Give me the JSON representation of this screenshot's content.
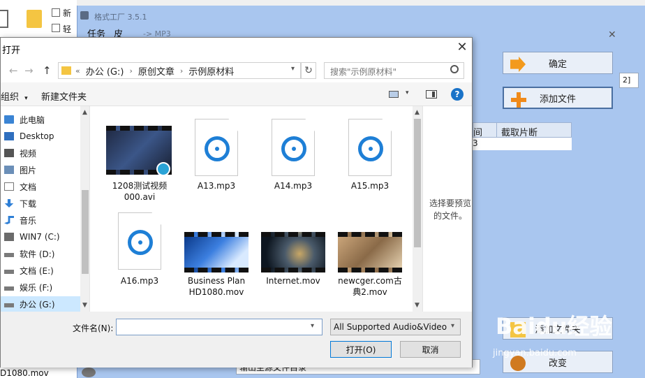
{
  "background_explorer": {
    "label_top1": "新",
    "label_top2": "轻",
    "bottom_file": "D1080.mov"
  },
  "format_factory": {
    "title": "格式工厂 3.5.1",
    "menu_task": "任务",
    "menu_skin": "皮",
    "crumb": "-> MP3",
    "confirm_button": "确定",
    "add_file_button": "添加文件",
    "table_col_time": "间",
    "table_col_clip": "截取片断",
    "row_value": "3",
    "side_num": "2]",
    "add_folder_button": "添加文件夹",
    "change_button": "改变",
    "bottom_field": "输出至源文件目录"
  },
  "dialog": {
    "title": "打开",
    "close_glyph": "✕",
    "breadcrumbs": [
      "«",
      "办公 (G:)",
      "原创文章",
      "示例原材料"
    ],
    "search_placeholder": "搜索\"示例原材料\"",
    "toolbar_organize": "组织",
    "toolbar_new_folder": "新建文件夹",
    "help_glyph": "?",
    "tree": [
      {
        "label": "此电脑",
        "icon": "computer-icon"
      },
      {
        "label": "Desktop",
        "icon": "desktop-icon"
      },
      {
        "label": "视频",
        "icon": "video-folder-icon"
      },
      {
        "label": "图片",
        "icon": "picture-folder-icon"
      },
      {
        "label": "文档",
        "icon": "document-folder-icon"
      },
      {
        "label": "下载",
        "icon": "download-icon"
      },
      {
        "label": "音乐",
        "icon": "music-icon"
      },
      {
        "label": "WIN7 (C:)",
        "icon": "windows-drive-icon"
      },
      {
        "label": "软件 (D:)",
        "icon": "drive-icon"
      },
      {
        "label": "文档 (E:)",
        "icon": "drive-icon"
      },
      {
        "label": "娱乐 (F:)",
        "icon": "drive-icon"
      },
      {
        "label": "办公 (G:)",
        "icon": "drive-icon",
        "selected": true
      }
    ],
    "files": [
      {
        "name_line1": "1208测试视频",
        "name_line2": "000.avi",
        "kind": "video"
      },
      {
        "name_line1": "A13.mp3",
        "name_line2": "",
        "kind": "audio"
      },
      {
        "name_line1": "A14.mp3",
        "name_line2": "",
        "kind": "audio"
      },
      {
        "name_line1": "A15.mp3",
        "name_line2": "",
        "kind": "audio"
      },
      {
        "name_line1": "A16.mp3",
        "name_line2": "",
        "kind": "audio"
      },
      {
        "name_line1": "Business Plan",
        "name_line2": "HD1080.mov",
        "kind": "video"
      },
      {
        "name_line1": "Internet.mov",
        "name_line2": "",
        "kind": "video"
      },
      {
        "name_line1": "newcger.com古",
        "name_line2": "典2.mov",
        "kind": "video"
      }
    ],
    "preview_text": "选择要预览的文件。",
    "filename_label": "文件名(N):",
    "filename_value": "",
    "filetype_value": "All Supported Audio&Video",
    "open_button": "打开(O)",
    "cancel_button": "取消"
  },
  "watermark": {
    "brand": "Baidu经验",
    "url": "jingyan.baidu.com"
  },
  "colors": {
    "accent": "#0078d7",
    "app_bg": "#a9c6ef",
    "mp3_icon": "#1e7fd6",
    "selected_row": "#cce8ff"
  }
}
